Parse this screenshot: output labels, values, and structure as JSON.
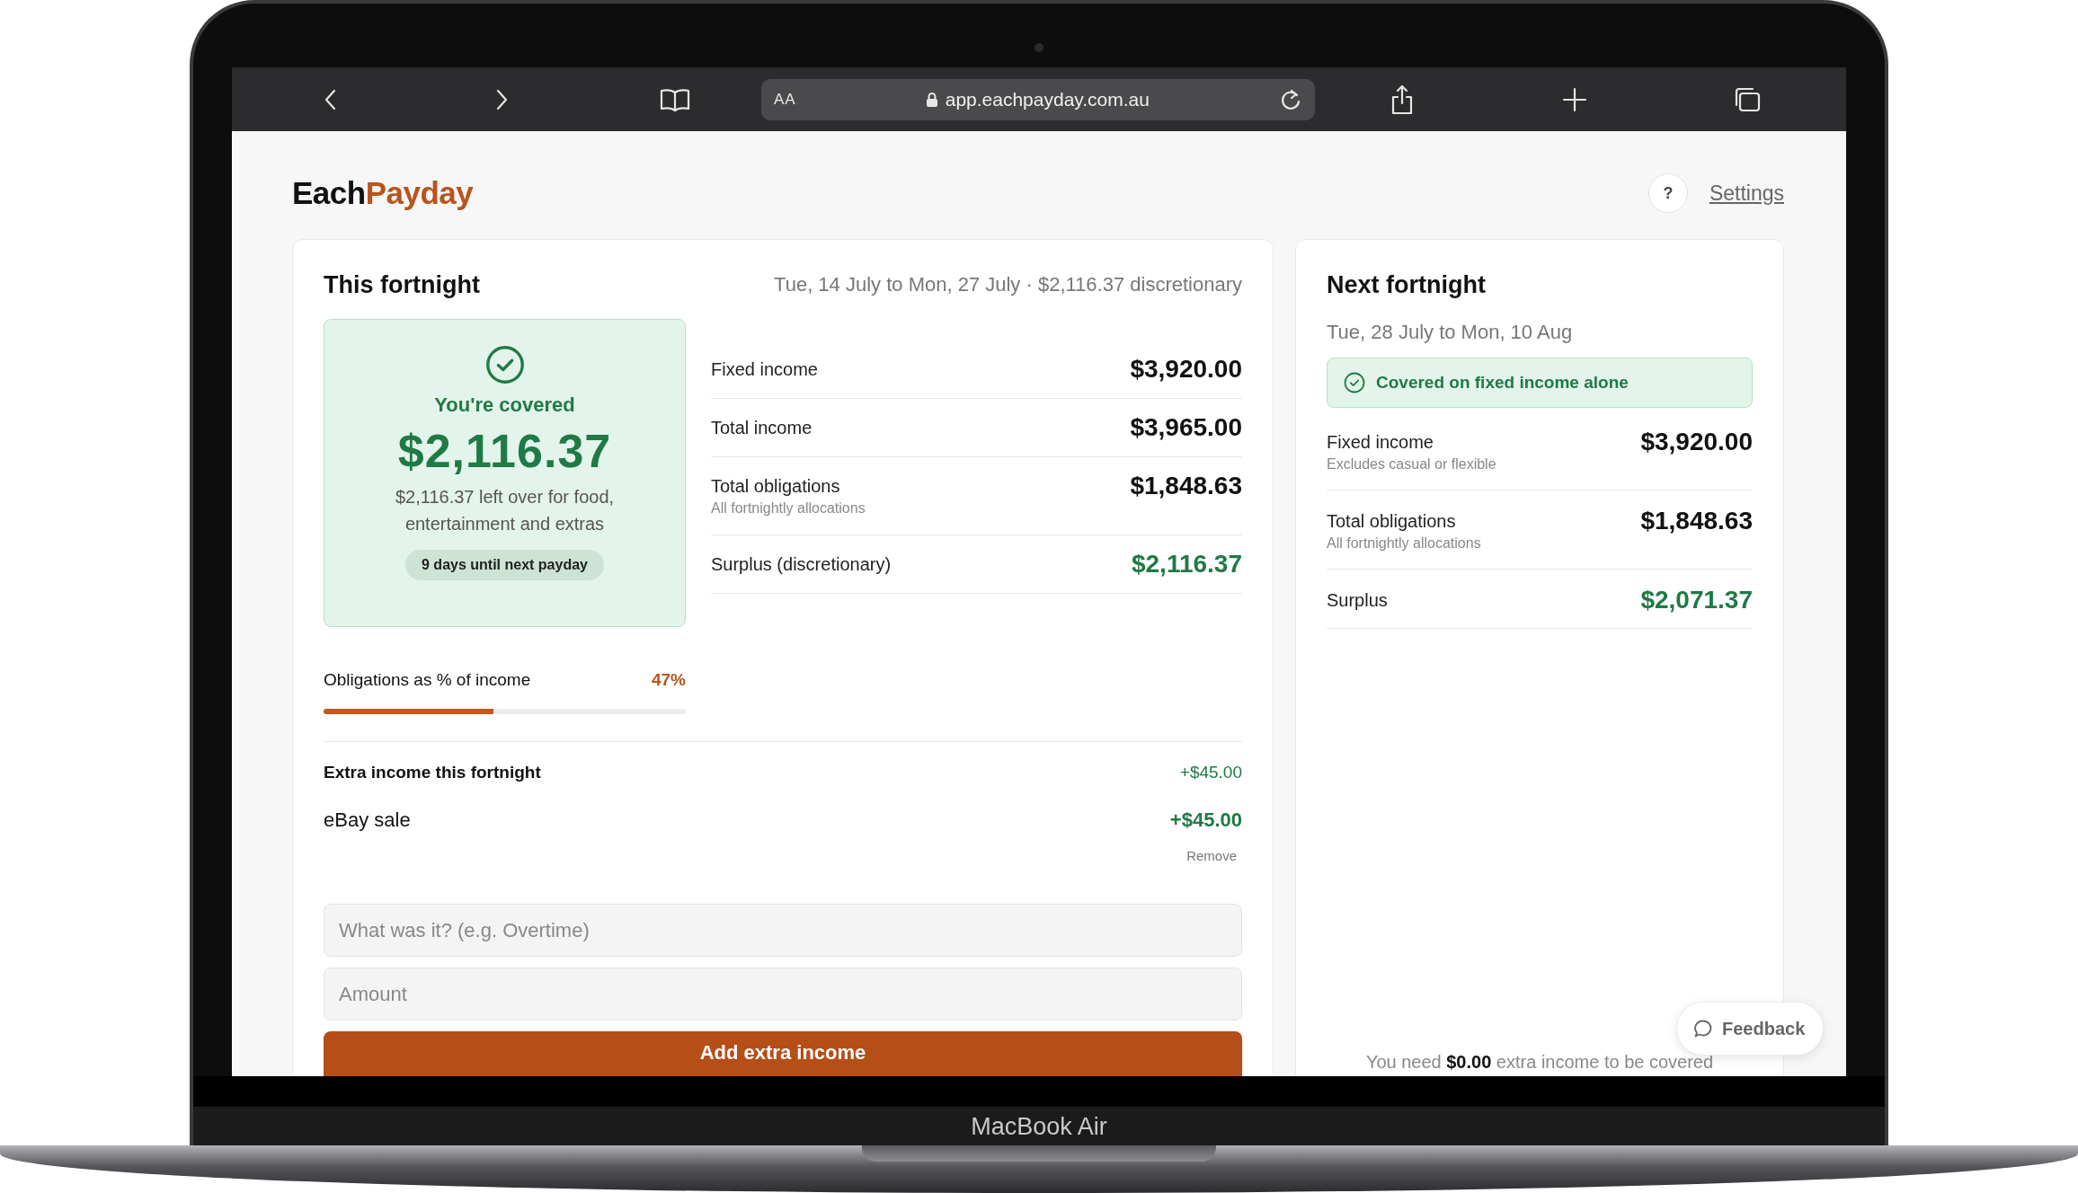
{
  "browser": {
    "text_size": "AA",
    "address": "app.eachpayday.com.au"
  },
  "header": {
    "logo": {
      "first": "Each",
      "second": "Payday"
    },
    "help": "?",
    "settings": "Settings"
  },
  "this_fortnight": {
    "title": "This fortnight",
    "period": "Tue, 14 July to Mon, 27 July · $2,116.37 discretionary",
    "status": {
      "heading": "You're covered",
      "amount": "$2,116.37",
      "description": "$2,116.37 left over for food, entertainment and extras",
      "badge": "9 days until next payday"
    },
    "metrics": [
      {
        "label": "Fixed income",
        "value": "$3,920.00",
        "kind": "plain"
      },
      {
        "label": "Total income",
        "value": "$3,965.00",
        "kind": "plain"
      },
      {
        "label": "Total obligations",
        "sublabel": "All fortnightly allocations",
        "value": "$1,848.63",
        "kind": "plain"
      },
      {
        "label": "Surplus (discretionary)",
        "value": "$2,116.37",
        "kind": "positive"
      }
    ],
    "obligations_ratio": {
      "label": "Obligations as % of income",
      "reading": "47%",
      "level": 0.47
    },
    "extra_income": {
      "title": "Extra income this fortnight",
      "total": "+$45.00",
      "items": [
        {
          "name": "eBay sale",
          "amount": "+$45.00",
          "action": "Remove"
        }
      ]
    },
    "form": {
      "fields": [
        {
          "placeholder": "What was it? (e.g. Overtime)"
        },
        {
          "placeholder": "Amount"
        }
      ],
      "button": "Add extra income"
    }
  },
  "next_fortnight": {
    "title": "Next fortnight",
    "period": "Tue, 28 July to Mon, 10 Aug",
    "banner": "Covered on fixed income alone",
    "metrics": [
      {
        "label": "Fixed income",
        "sublabel": "Excludes casual or flexible",
        "value": "$3,920.00",
        "kind": "plain"
      },
      {
        "label": "Total obligations",
        "sublabel": "All fortnightly allocations",
        "value": "$1,848.63",
        "kind": "plain"
      },
      {
        "label": "Surplus",
        "value": "$2,071.37",
        "kind": "positive"
      }
    ],
    "note": "You need **$0.00** extra income to be covered"
  },
  "feedback": "Feedback",
  "laptop": {
    "label": "MacBook Air"
  }
}
